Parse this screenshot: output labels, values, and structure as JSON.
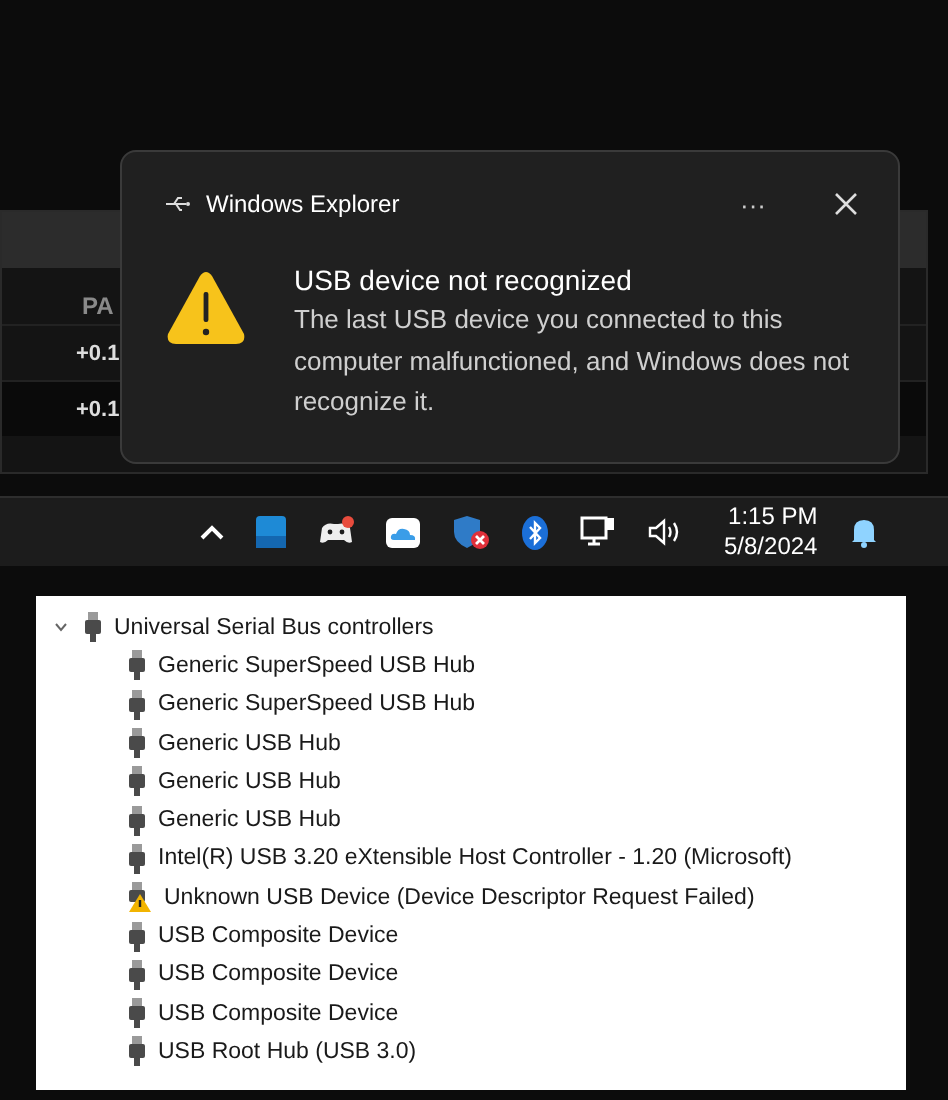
{
  "background_app": {
    "column_header": "PA",
    "cells": [
      "+0.1",
      "+0.1"
    ]
  },
  "notification": {
    "app_name": "Windows Explorer",
    "more_glyph": "···",
    "title": "USB device not recognized",
    "body": "The last USB device you connected to this computer malfunctioned, and Windows does not recognize it."
  },
  "taskbar": {
    "time": "1:15 PM",
    "date": "5/8/2024"
  },
  "device_tree": {
    "label": "Universal Serial Bus controllers",
    "expanded": true,
    "children": [
      {
        "label": "Generic SuperSpeed USB Hub",
        "kind": "usb"
      },
      {
        "label": "Generic SuperSpeed USB Hub",
        "kind": "usb"
      },
      {
        "label": "Generic USB Hub",
        "kind": "usb"
      },
      {
        "label": "Generic USB Hub",
        "kind": "usb"
      },
      {
        "label": "Generic USB Hub",
        "kind": "usb"
      },
      {
        "label": "Intel(R) USB 3.20 eXtensible Host Controller - 1.20 (Microsoft)",
        "kind": "usb"
      },
      {
        "label": "Unknown USB Device (Device Descriptor Request Failed)",
        "kind": "warning"
      },
      {
        "label": "USB Composite Device",
        "kind": "usb"
      },
      {
        "label": "USB Composite Device",
        "kind": "usb"
      },
      {
        "label": "USB Composite Device",
        "kind": "usb"
      },
      {
        "label": "USB Root Hub (USB 3.0)",
        "kind": "usb"
      }
    ]
  }
}
